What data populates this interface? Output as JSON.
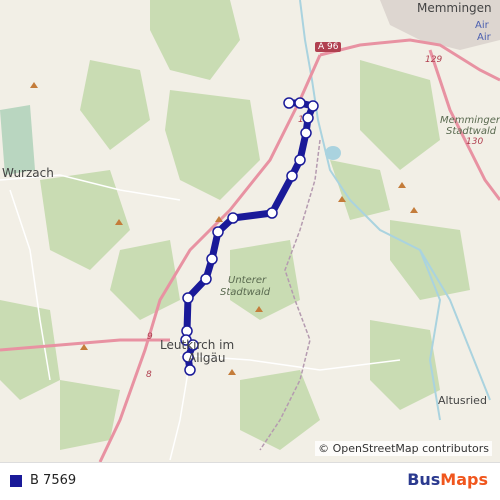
{
  "places": {
    "memmingen": "Memmingen",
    "wurzach": "Wurzach",
    "leutkirch_1": "Leutkirch im",
    "leutkirch_2": "Allgäu",
    "unterer_stadtwald_1": "Unterer",
    "unterer_stadtwald_2": "Stadtwald",
    "memminger_stadtwald_1": "Memminger",
    "memminger_stadtwald_2": "Stadtwald",
    "altusried": "Altusried",
    "air_1": "Air",
    "air_2": "Air"
  },
  "roads": {
    "a96": "A 96",
    "r129": "129",
    "r130": "130",
    "r9": "9",
    "r8": "8",
    "r1": "1"
  },
  "attribution": "© OpenStreetMap contributors",
  "legend": {
    "route_label": "B 7569",
    "route_color": "#1a1a99"
  },
  "brand": {
    "bus": "Bus",
    "maps": "Maps"
  }
}
